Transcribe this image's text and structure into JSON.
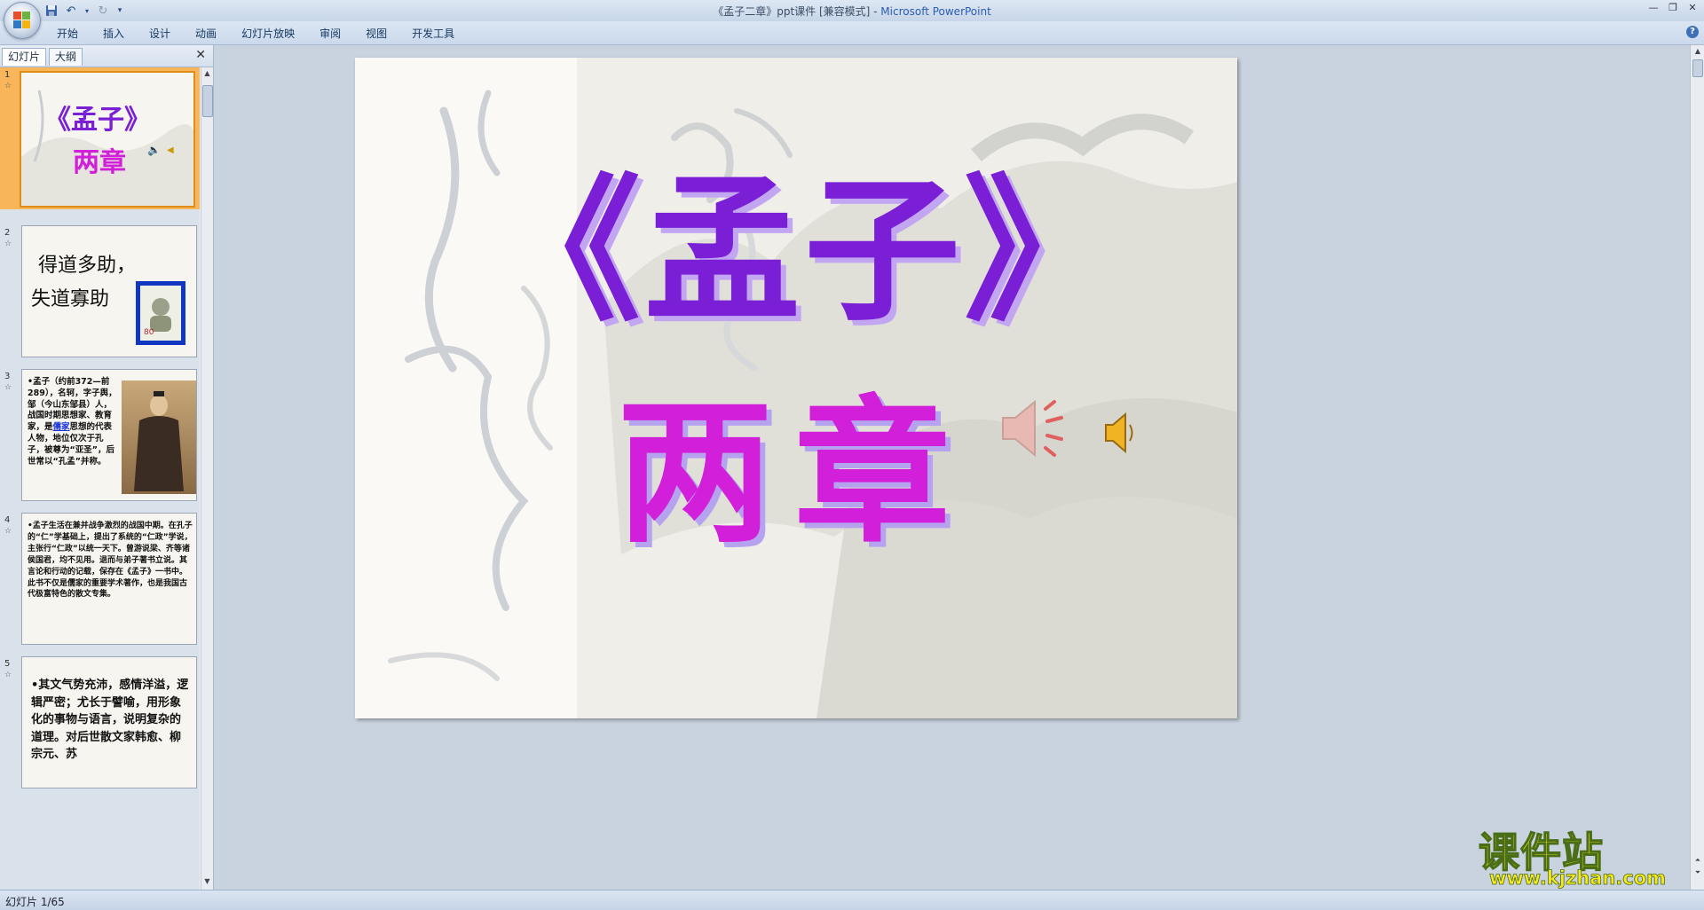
{
  "window": {
    "title_doc": "《孟子二章》ppt课件 [兼容模式]",
    "title_sep": " - ",
    "title_app": "Microsoft PowerPoint"
  },
  "ribbon": {
    "tabs": [
      "开始",
      "插入",
      "设计",
      "动画",
      "幻灯片放映",
      "审阅",
      "视图",
      "开发工具"
    ]
  },
  "pane": {
    "tab_slides": "幻灯片",
    "tab_outline": "大纲"
  },
  "thumbnails": [
    {
      "num": "1",
      "line1": "《孟子》",
      "line2": "两章"
    },
    {
      "num": "2",
      "line1": "得道多助，",
      "line2": "失道寡助",
      "stamp_value": "80"
    },
    {
      "num": "3",
      "text": "•孟子（约前372—前289），名轲，字子舆，邹（今山东邹县）人，战国时期思想家、教育家，是儒家思想的代表人物，地位仅次于孔子，被尊为“亚圣”，后世常以“孔孟”并称。",
      "link": "儒家"
    },
    {
      "num": "4",
      "text": "•孟子生活在兼并战争激烈的战国中期。在孔子的“仁”学基础上，提出了系统的“仁政”学说，主张行“仁政”以统一天下。曾游说梁、齐等诸侯国君，均不见用。退而与弟子著书立说。其言论和行动的记载，保存在《孟子》一书中。此书不仅是儒家的重要学术著作，也是我国古代极富特色的散文专集。"
    },
    {
      "num": "5",
      "text": "•其文气势充沛，感情洋溢，逻辑严密；尤长于譬喻，用形象化的事物与语言，说明复杂的道理。对后世散文家韩愈、柳宗元、苏"
    }
  ],
  "slide": {
    "title": "《孟子》",
    "subtitle": "两章"
  },
  "status": {
    "slide_indicator": "幻灯片 1/65"
  },
  "watermark": {
    "name": "课件站",
    "url": "www.kjzhan.com"
  },
  "colors": {
    "title_purple": "#7a1fd6",
    "subtitle_magenta": "#d21fd9",
    "selection_orange": "#f8b55a",
    "link_blue": "#1a35d8"
  }
}
